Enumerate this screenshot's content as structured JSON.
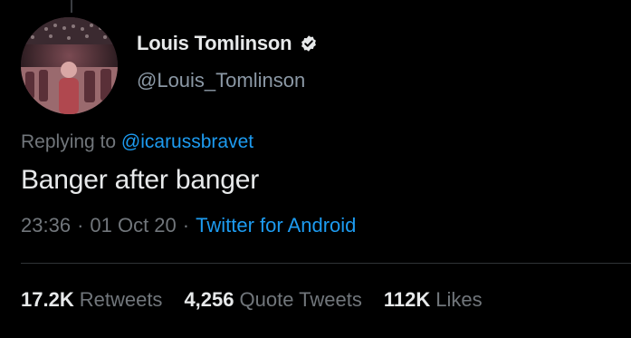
{
  "author": {
    "display_name": "Louis Tomlinson",
    "handle": "@Louis_Tomlinson",
    "verified": true,
    "avatar_icon": "profile-photo-concert-crowd"
  },
  "tweet": {
    "replying_prefix": "Replying to",
    "replying_to": "@icarussbravet",
    "text": "Banger after banger",
    "time": "23:36",
    "date": "01 Oct 20",
    "separator": "·",
    "source": "Twitter for Android"
  },
  "stats": {
    "retweets_count": "17.2K",
    "retweets_label": "Retweets",
    "quotes_count": "4,256",
    "quotes_label": "Quote Tweets",
    "likes_count": "112K",
    "likes_label": "Likes"
  },
  "colors": {
    "background": "#000000",
    "primary_text": "#e7e9ea",
    "secondary_text": "#71767b",
    "accent_blue": "#1d9bf0",
    "divider": "#2f3336"
  }
}
